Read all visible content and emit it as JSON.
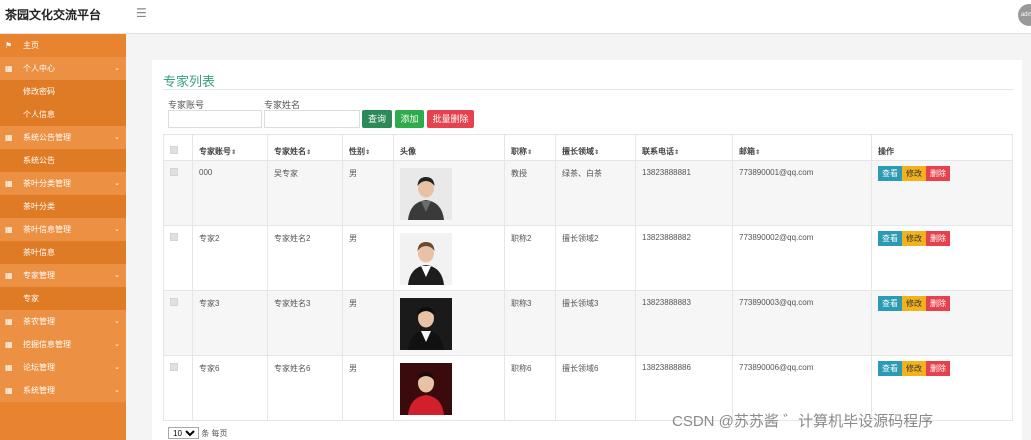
{
  "header": {
    "brand": "茶园文化交流平台",
    "menu_icon": "menu-icon",
    "avatar_text": "admin"
  },
  "sidebar": {
    "items": [
      {
        "label": "主页",
        "type": "home"
      },
      {
        "label": "个人中心",
        "type": "group"
      },
      {
        "label": "修改密码",
        "type": "sub"
      },
      {
        "label": "个人信息",
        "type": "sub"
      },
      {
        "label": "系统公告管理",
        "type": "group"
      },
      {
        "label": "系统公告",
        "type": "sub"
      },
      {
        "label": "茶叶分类管理",
        "type": "group"
      },
      {
        "label": "茶叶分类",
        "type": "sub"
      },
      {
        "label": "茶叶信息管理",
        "type": "group"
      },
      {
        "label": "茶叶信息",
        "type": "sub"
      },
      {
        "label": "专家管理",
        "type": "group"
      },
      {
        "label": "专家",
        "type": "sub"
      },
      {
        "label": "茶农管理",
        "type": "group"
      },
      {
        "label": "挖掘信息管理",
        "type": "group"
      },
      {
        "label": "论坛管理",
        "type": "group"
      },
      {
        "label": "系统管理",
        "type": "group"
      }
    ]
  },
  "main": {
    "title": "专家列表",
    "search": {
      "account_label": "专家账号",
      "name_label": "专家姓名",
      "account_value": "",
      "name_value": "",
      "query_label": "查询",
      "add_label": "添加",
      "batch_delete_label": "批量删除"
    },
    "table": {
      "columns": [
        "专家账号",
        "专家姓名",
        "性别",
        "头像",
        "职称",
        "擅长领域",
        "联系电话",
        "邮箱",
        "操作"
      ],
      "rows": [
        {
          "account": "000",
          "name": "吴专家",
          "gender": "男",
          "title": "教授",
          "field": "绿茶、白茶",
          "phone": "13823888881",
          "email": "773890001@qq.com"
        },
        {
          "account": "专家2",
          "name": "专家姓名2",
          "gender": "男",
          "title": "职称2",
          "field": "擅长领域2",
          "phone": "13823888882",
          "email": "773890002@qq.com"
        },
        {
          "account": "专家3",
          "name": "专家姓名3",
          "gender": "男",
          "title": "职称3",
          "field": "擅长领域3",
          "phone": "13823888883",
          "email": "773890003@qq.com"
        },
        {
          "account": "专家6",
          "name": "专家姓名6",
          "gender": "男",
          "title": "职称6",
          "field": "擅长领域6",
          "phone": "13823888886",
          "email": "773890006@qq.com"
        }
      ],
      "actions": {
        "view": "查看",
        "edit": "修改",
        "delete": "删除"
      }
    },
    "pager": {
      "page_size": "10",
      "per_page_text": "条 每页"
    }
  },
  "watermark": "CSDN @苏苏酱 ゛计算机毕设源码程序",
  "colors": {
    "sidebar": "#e8842f",
    "accent": "#3aa07a",
    "danger": "#e6424d",
    "warning": "#f1b21c",
    "info": "#2a9ab5"
  }
}
